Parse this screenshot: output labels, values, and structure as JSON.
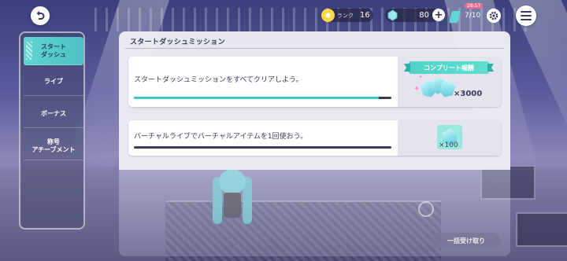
{
  "topbar": {
    "rank_label": "ランク",
    "rank_value": "16",
    "gems_value": "80",
    "stamina_timer": "28:57",
    "stamina_value": "7/10"
  },
  "sidebar": {
    "tabs": [
      {
        "label_line1": "スタート",
        "label_line2": "ダッシュ",
        "active": true
      },
      {
        "label_line1": "ライブ",
        "label_line2": "",
        "active": false
      },
      {
        "label_line1": "ボーナス",
        "label_line2": "",
        "active": false
      },
      {
        "label_line1": "称号",
        "label_line2": "アチーブメント",
        "active": false
      }
    ]
  },
  "panel": {
    "title": "スタートダッシュミッション",
    "missions": [
      {
        "text": "スタートダッシュミッションをすべてクリアしよう。",
        "progress": 0.95,
        "reward_badge": "コンプリート報酬",
        "reward_count": "×3000"
      },
      {
        "text": "バーチャルライブでバーチャルアイテムを1回使おう。",
        "progress": 0.0,
        "reward_count": "×100"
      }
    ],
    "claim_all_label": "一括受け取り"
  },
  "colors": {
    "accent": "#4fd3c6",
    "text_dark": "#3a3b58",
    "panel_bg": "#ececf4"
  }
}
